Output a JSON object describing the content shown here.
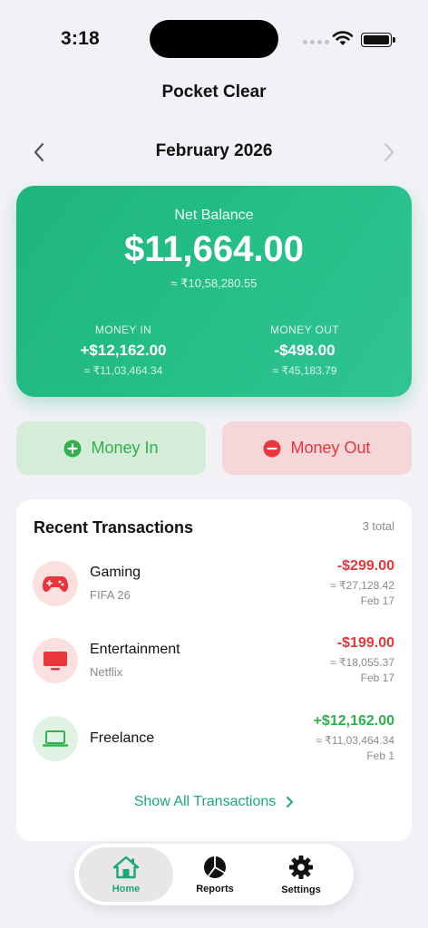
{
  "status_bar": {
    "time": "3:18"
  },
  "app": {
    "title": "Pocket Clear"
  },
  "month_nav": {
    "label": "February 2026"
  },
  "balance": {
    "label": "Net Balance",
    "amount": "$11,664.00",
    "converted": "≈ ₹10,58,280.55",
    "money_in": {
      "label": "MONEY IN",
      "amount": "+$12,162.00",
      "converted": "≈ ₹11,03,464.34"
    },
    "money_out": {
      "label": "MONEY OUT",
      "amount": "-$498.00",
      "converted": "≈ ₹45,183.79"
    }
  },
  "actions": {
    "money_in_label": "Money In",
    "money_out_label": "Money Out"
  },
  "transactions": {
    "title": "Recent Transactions",
    "count": "3 total",
    "items": [
      {
        "name": "Gaming",
        "sub": "FIFA 26",
        "amount": "-$299.00",
        "converted": "≈ ₹27,128.42",
        "date": "Feb 17",
        "icon": "gamepad-icon"
      },
      {
        "name": "Entertainment",
        "sub": "Netflix",
        "amount": "-$199.00",
        "converted": "≈ ₹18,055.37",
        "date": "Feb 17",
        "icon": "tv-icon"
      },
      {
        "name": "Freelance",
        "sub": "",
        "amount": "+$12,162.00",
        "converted": "≈ ₹11,03,464.34",
        "date": "Feb 1",
        "icon": "laptop-icon"
      }
    ],
    "show_all": "Show All Transactions"
  },
  "tab_bar": {
    "home": "Home",
    "reports": "Reports",
    "settings": "Settings"
  },
  "colors": {
    "accent": "#1aa878",
    "income": "#2fb14d",
    "expense": "#e9353c",
    "card_green": "#24bf86"
  }
}
